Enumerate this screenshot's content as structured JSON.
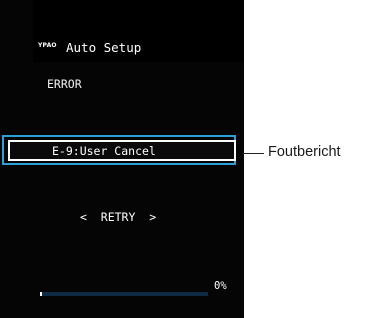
{
  "screen": {
    "brand_logo_text": "YPAO",
    "title": "Auto Setup",
    "status_label": "ERROR",
    "error_message": "E-9:User Cancel",
    "retry_label": "<  RETRY  >",
    "progress": {
      "percent_text": "0%",
      "value": 0.01
    }
  },
  "callout": {
    "label": "Foutbericht"
  },
  "colors": {
    "highlight_border": "#2a9fd8",
    "screen_background": "#050505",
    "progress_track": "#0f2a44"
  }
}
